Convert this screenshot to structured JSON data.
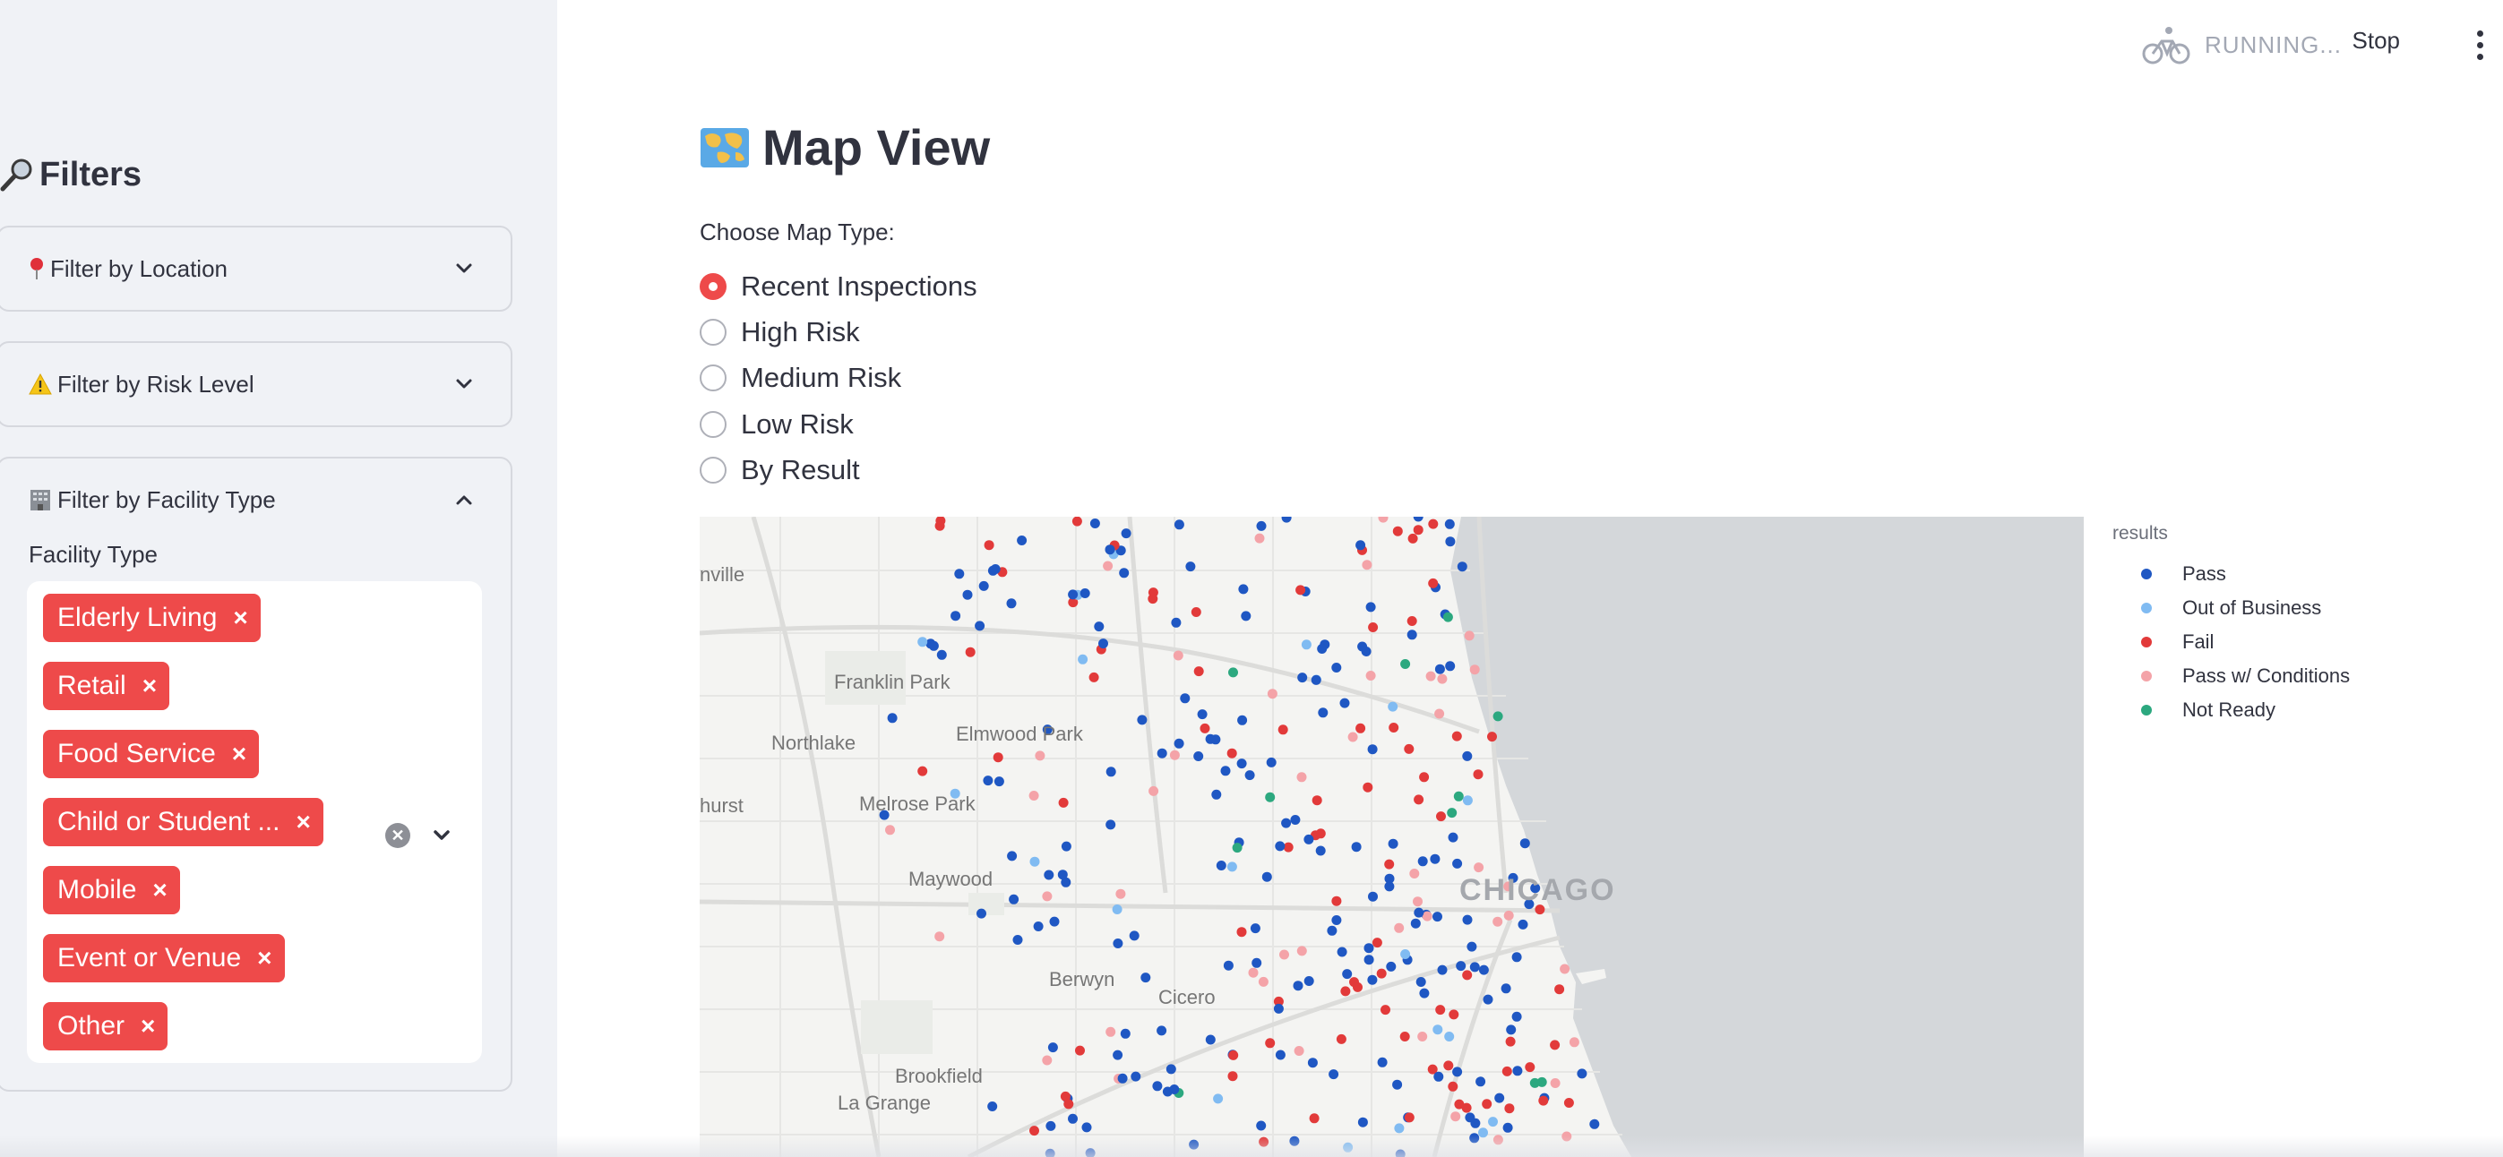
{
  "sidebar": {
    "title": "Filters",
    "title_icon": "magnifier-icon",
    "expanders": [
      {
        "label": "Filter by Location",
        "icon": "round-pushpin-icon",
        "expanded": false
      },
      {
        "label": "Filter by Risk Level",
        "icon": "warning-icon",
        "expanded": false
      },
      {
        "label": "Filter by Facility Type",
        "icon": "office-building-icon",
        "expanded": true
      }
    ],
    "facility_filter": {
      "label": "Facility Type",
      "selected": [
        "Elderly Living",
        "Retail",
        "Food Service",
        "Child or Student ...",
        "Mobile",
        "Event or Venue",
        "Other"
      ],
      "remove_glyph": "×"
    }
  },
  "header": {
    "status": "RUNNING...",
    "status_icon": "bicycle-icon",
    "stop_label": "Stop",
    "menu_icon": "kebab-menu-icon"
  },
  "main": {
    "title": "Map View",
    "title_icon": "world-map-icon",
    "radio_label": "Choose Map Type:",
    "options": [
      "Recent Inspections",
      "High Risk",
      "Medium Risk",
      "Low Risk",
      "By Result"
    ],
    "selected_option": "Recent Inspections"
  },
  "map": {
    "place_labels": [
      "nville",
      "Franklin Park",
      "Northlake",
      "Elmwood Park",
      "hurst",
      "Melrose Park",
      "Maywood",
      "Berwyn",
      "Cicero",
      "Brookfield",
      "La Grange"
    ],
    "city_label": "CHICAGO"
  },
  "legend": {
    "title": "results",
    "items": [
      {
        "label": "Pass",
        "color": "#1f57c3"
      },
      {
        "label": "Out of Business",
        "color": "#80bbf2"
      },
      {
        "label": "Fail",
        "color": "#e23a3a"
      },
      {
        "label": "Pass w/ Conditions",
        "color": "#f4a3a8"
      },
      {
        "label": "Not Ready",
        "color": "#2ca87f"
      }
    ]
  },
  "colors": {
    "accent": "#ee4a4a",
    "sidebar_bg": "#f0f2f6",
    "lake": "#d4d7da"
  }
}
